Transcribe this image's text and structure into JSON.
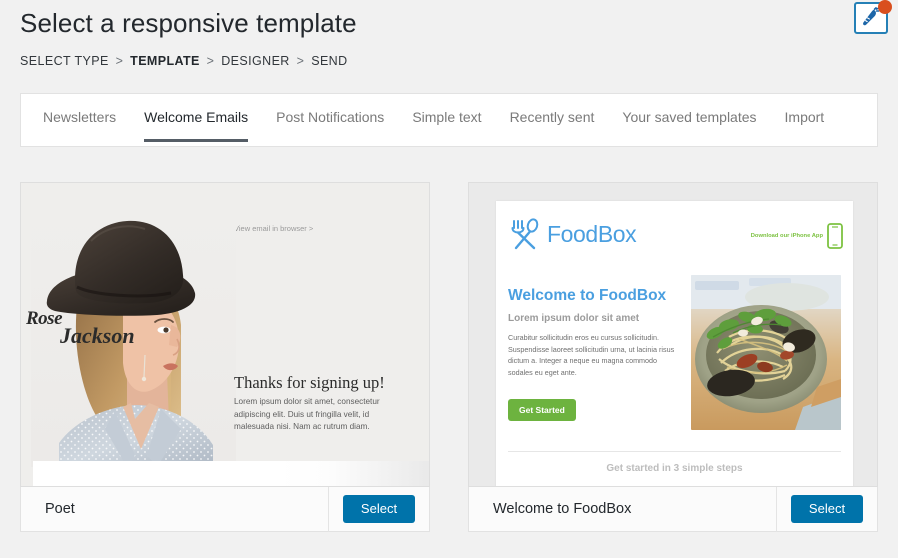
{
  "header": {
    "title": "Select a responsive template",
    "breadcrumb": [
      {
        "label": "SELECT TYPE",
        "active": false
      },
      {
        "label": "TEMPLATE",
        "active": true
      },
      {
        "label": "DESIGNER",
        "active": false
      },
      {
        "label": "SEND",
        "active": false
      }
    ],
    "breadcrumb_separator": ">",
    "badge": {
      "icon": "carrot-icon",
      "notification": true,
      "border_color": "#2580b6",
      "dot_color": "#d94f1e",
      "icon_color": "#1c66a8"
    }
  },
  "tabs": [
    {
      "label": "Newsletters",
      "active": false
    },
    {
      "label": "Welcome Emails",
      "active": true
    },
    {
      "label": "Post Notifications",
      "active": false
    },
    {
      "label": "Simple text",
      "active": false
    },
    {
      "label": "Recently sent",
      "active": false
    },
    {
      "label": "Your saved templates",
      "active": false
    },
    {
      "label": "Import",
      "active": false
    }
  ],
  "templates": [
    {
      "name": "Poet",
      "select_label": "Select",
      "preview": {
        "view_in_browser": "View email in browser >",
        "signature_first": "Rose",
        "signature_last": "Jackson",
        "heading": "Thanks for signing up!",
        "body": "Lorem ipsum dolor sit amet, consectetur adipiscing elit. Duis ut fringilla velit, id malesuada nisi. Nam ac rutrum diam.",
        "photo_alt": "woman-in-hat-photo"
      }
    },
    {
      "name": "Welcome to FoodBox",
      "select_label": "Select",
      "preview": {
        "brand": "FoodBox",
        "app_promo": "Download our iPhone App",
        "headline": "Welcome to FoodBox",
        "subheading": "Lorem ipsum dolor sit amet",
        "body": "Curabitur sollicitudin eros eu cursus sollicitudin. Suspendisse laoreet sollicitudin urna, ut lacinia risus dictum a. Integer a neque eu magna commodo sodales eu eget ante.",
        "cta_label": "Get Started",
        "steps_text": "Get started in 3 simple steps",
        "photo_alt": "pasta-bowl-photo"
      }
    }
  ],
  "colors": {
    "page_background": "#f1f1f1",
    "accent_blue": "#0073aa",
    "foodbox_blue": "#4a9fe0",
    "foodbox_green": "#6db33f",
    "tab_active_underline": "#555d66"
  }
}
